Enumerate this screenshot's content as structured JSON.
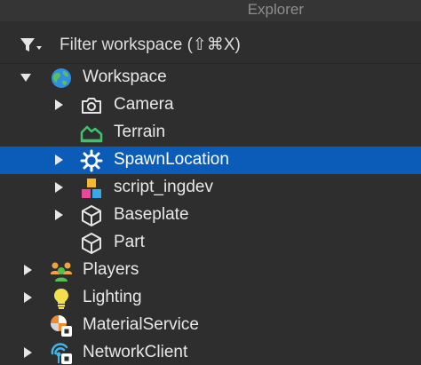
{
  "panel": {
    "title": "Explorer",
    "filter": {
      "icon": "filter-icon",
      "placeholder": "Filter workspace (⇧⌘X)"
    }
  },
  "colors": {
    "background": "#2e2e2e",
    "selection": "#0b5cb8",
    "text": "#e8e8e8",
    "terrain": "#3ec46d",
    "lighting": "#f4e04d"
  },
  "tree": {
    "items": [
      {
        "label": "Workspace",
        "icon": "globe-icon",
        "expanded": true
      },
      {
        "label": "Camera",
        "icon": "camera-icon",
        "expandable": true
      },
      {
        "label": "Terrain",
        "icon": "terrain-icon",
        "expandable": false
      },
      {
        "label": "SpawnLocation",
        "icon": "spawn-location-icon",
        "expandable": true,
        "selected": true
      },
      {
        "label": "script_ingdev",
        "icon": "model-icon",
        "expandable": true
      },
      {
        "label": "Baseplate",
        "icon": "part-icon",
        "expandable": true
      },
      {
        "label": "Part",
        "icon": "part-icon",
        "expandable": false
      },
      {
        "label": "Players",
        "icon": "players-icon",
        "expandable": true
      },
      {
        "label": "Lighting",
        "icon": "lightbulb-icon",
        "expandable": true
      },
      {
        "label": "MaterialService",
        "icon": "material-service-icon",
        "expandable": false
      },
      {
        "label": "NetworkClient",
        "icon": "network-client-icon",
        "expandable": true
      }
    ]
  }
}
